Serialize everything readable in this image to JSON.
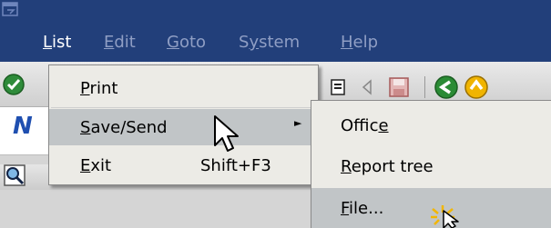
{
  "menubar": {
    "items": [
      {
        "text": "List",
        "accel": "L",
        "rest": "ist"
      },
      {
        "text": "Edit",
        "accel": "E",
        "rest": "dit"
      },
      {
        "text": "Goto",
        "accel": "G",
        "rest": "oto"
      },
      {
        "text": "System",
        "accel": "y",
        "pre": "S",
        "rest": "stem"
      },
      {
        "text": "Help",
        "accel": "H",
        "rest": "elp"
      }
    ]
  },
  "dropdown": {
    "items": [
      {
        "accel": "P",
        "rest": "rint"
      },
      {
        "accel": "S",
        "rest": "ave/Send"
      },
      {
        "accel": "E",
        "pre": "",
        "rest": "xit",
        "mid": "x"
      },
      {
        "shortcut": "Shift+F3"
      }
    ]
  },
  "submenu": {
    "items": [
      {
        "pre": "Offic",
        "accel": "e",
        "rest": ""
      },
      {
        "accel": "R",
        "rest": "eport tree"
      },
      {
        "accel": "F",
        "rest": "ile..."
      }
    ]
  },
  "partial_text": "N",
  "colors": {
    "titlebar": "#223f7a",
    "menu_active": "#ffffff",
    "menu_inactive": "#8f9ec4",
    "selection": "#c1c5c7"
  }
}
